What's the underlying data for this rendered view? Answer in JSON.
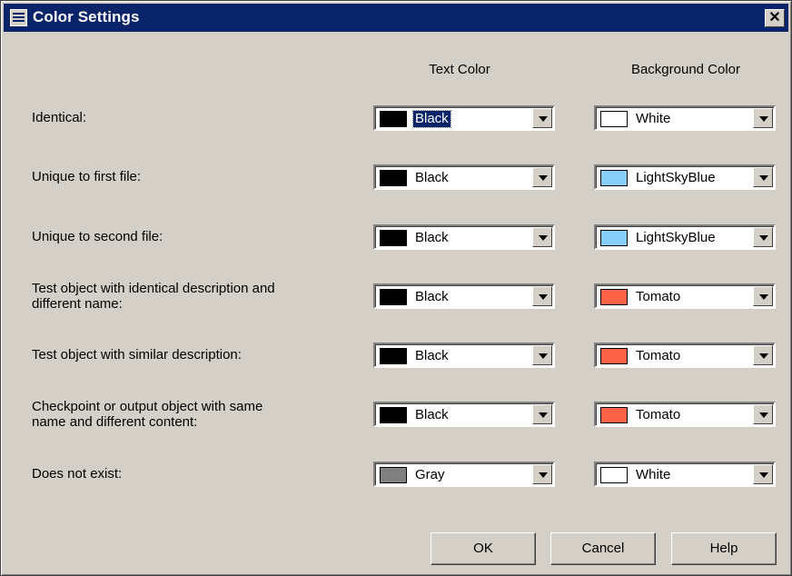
{
  "window": {
    "title": "Color Settings",
    "close_glyph": "✕"
  },
  "headers": {
    "text_color": "Text Color",
    "background_color": "Background Color"
  },
  "rows": [
    {
      "label": "Identical:",
      "text_color": {
        "name": "Black",
        "hex": "#000000"
      },
      "bg_color": {
        "name": "White",
        "hex": "#ffffff"
      }
    },
    {
      "label": "Unique to first file:",
      "text_color": {
        "name": "Black",
        "hex": "#000000"
      },
      "bg_color": {
        "name": "LightSkyBlue",
        "hex": "#87cefa"
      }
    },
    {
      "label": "Unique to second file:",
      "text_color": {
        "name": "Black",
        "hex": "#000000"
      },
      "bg_color": {
        "name": "LightSkyBlue",
        "hex": "#87cefa"
      }
    },
    {
      "label": "Test object with identical description and\ndifferent name:",
      "text_color": {
        "name": "Black",
        "hex": "#000000"
      },
      "bg_color": {
        "name": "Tomato",
        "hex": "#ff6347"
      }
    },
    {
      "label": "Test object with similar description:",
      "text_color": {
        "name": "Black",
        "hex": "#000000"
      },
      "bg_color": {
        "name": "Tomato",
        "hex": "#ff6347"
      }
    },
    {
      "label": "Checkpoint or output object with same\nname and different content:",
      "text_color": {
        "name": "Black",
        "hex": "#000000"
      },
      "bg_color": {
        "name": "Tomato",
        "hex": "#ff6347"
      }
    },
    {
      "label": "Does not exist:",
      "text_color": {
        "name": "Gray",
        "hex": "#808080"
      },
      "bg_color": {
        "name": "White",
        "hex": "#ffffff"
      }
    }
  ],
  "buttons": {
    "ok": "OK",
    "cancel": "Cancel",
    "help": "Help"
  },
  "icons": {
    "window_icon": "window-settings-icon",
    "dropdown": "chevron-down-icon"
  }
}
